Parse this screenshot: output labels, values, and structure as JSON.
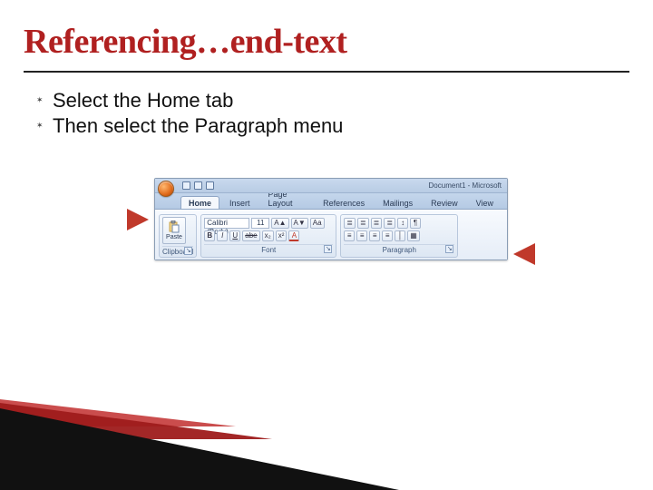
{
  "title": "Referencing…end-text",
  "bullets": [
    "Select the Home tab",
    "Then select the Paragraph menu"
  ],
  "ribbon": {
    "doc_title": "Document1 - Microsoft",
    "tabs": [
      "Home",
      "Insert",
      "Page Layout",
      "References",
      "Mailings",
      "Review",
      "View"
    ],
    "active_tab": 0,
    "clipboard": {
      "label": "Clipboard",
      "paste": "Paste"
    },
    "font": {
      "label": "Font",
      "family": "Calibri (Body)",
      "size": "11",
      "buttons_r1": [
        "A▲",
        "A▼",
        "Aa"
      ],
      "buttons_r2": [
        "B",
        "I",
        "U",
        "abe",
        "x₂",
        "x²",
        "A"
      ]
    },
    "paragraph": {
      "label": "Paragraph",
      "buttons_r1": [
        "≣",
        "≣",
        "≣",
        "≣",
        "↕",
        "¶"
      ],
      "buttons_r2": [
        "≡",
        "≡",
        "≡",
        "≡",
        "│",
        "▦"
      ]
    }
  }
}
